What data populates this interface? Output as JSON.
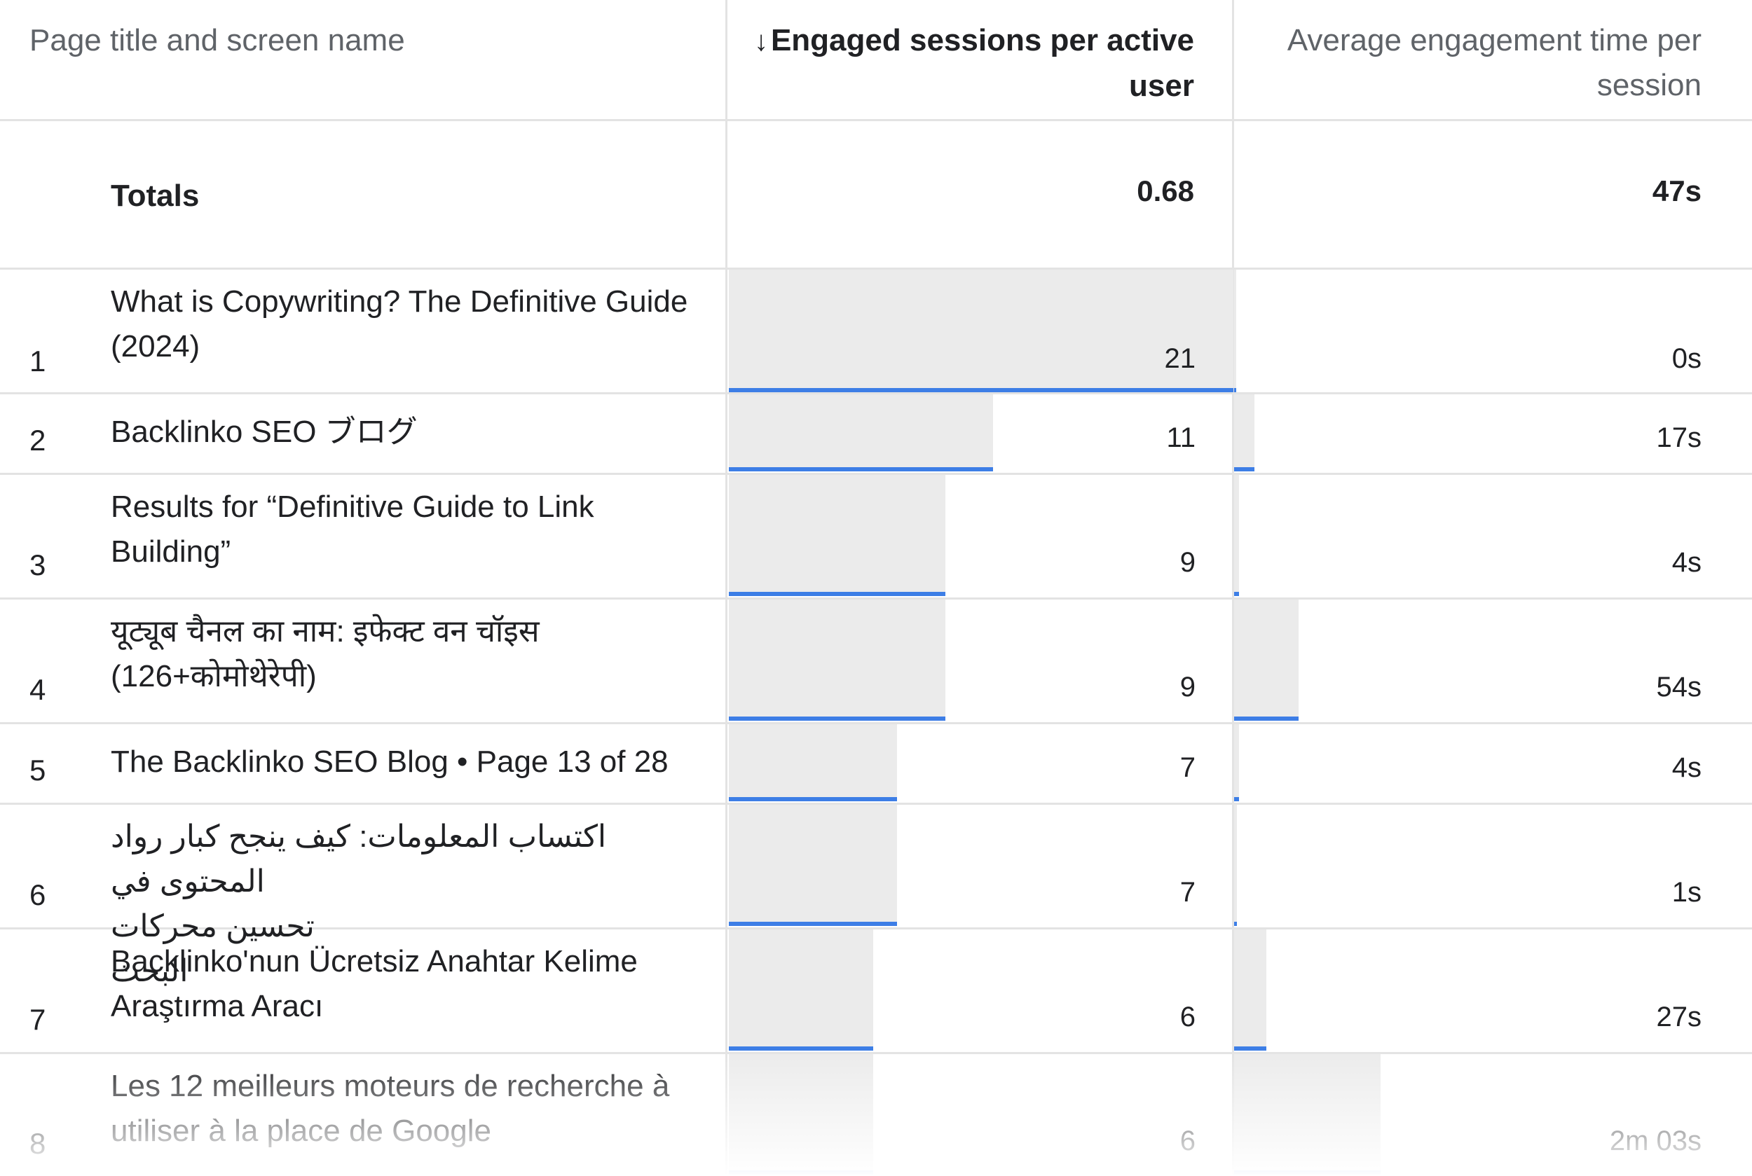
{
  "header": {
    "col1": "Page title and screen name",
    "col2_arrow": "↓",
    "col2_line1": "Engaged sessions per active",
    "col2_line2": "user",
    "col3_line1": "Average engagement time per",
    "col3_line2": "session"
  },
  "totals": {
    "label": "Totals",
    "engaged": "0.68",
    "avg_time": "47s"
  },
  "rows": [
    {
      "rank": "1",
      "title1": "What is Copywriting? The Definitive Guide",
      "title2": "(2024)",
      "engaged": "21",
      "engaged_fraction": 1.0,
      "time": "0s",
      "time_fraction": 0.0
    },
    {
      "rank": "2",
      "title1": "Backlinko SEO ブログ",
      "title2": "",
      "engaged": "11",
      "engaged_fraction": 0.524,
      "time": "17s",
      "time_fraction": 0.14
    },
    {
      "rank": "3",
      "title1": "Results for “Definitive Guide to Link",
      "title2": "Building”",
      "engaged": "9",
      "engaged_fraction": 0.429,
      "time": "4s",
      "time_fraction": 0.033
    },
    {
      "rank": "4",
      "title1": "यूट्यूब चैनल का नाम: इफेक्ट वन चॉइस",
      "title2": "(126+कोमोथेरेपी)",
      "engaged": "9",
      "engaged_fraction": 0.429,
      "time": "54s",
      "time_fraction": 0.44
    },
    {
      "rank": "5",
      "title1": "The Backlinko SEO Blog • Page 13 of 28",
      "title2": "",
      "engaged": "7",
      "engaged_fraction": 0.333,
      "time": "4s",
      "time_fraction": 0.033
    },
    {
      "rank": "6",
      "title1": "اكتساب المعلومات: كيف ينجح كبار رواد المحتوى في",
      "title2": "تحسين محركات البحث",
      "engaged": "7",
      "engaged_fraction": 0.333,
      "time": "1s",
      "time_fraction": 0.008
    },
    {
      "rank": "7",
      "title1": "Backlinko'nun Ücretsiz Anahtar Kelime",
      "title2": "Araştırma Aracı",
      "engaged": "6",
      "engaged_fraction": 0.286,
      "time": "27s",
      "time_fraction": 0.22
    },
    {
      "rank": "8",
      "title1": "Les 12 meilleurs moteurs de recherche à",
      "title2": "utiliser à la place de Google",
      "engaged": "6",
      "engaged_fraction": 0.286,
      "time": "2m 03s",
      "time_fraction": 1.0
    }
  ],
  "colors": {
    "accent": "#3d7ee6",
    "bar_fill": "#ebebeb",
    "border": "#e3e3e3",
    "muted_text": "#5f6368"
  }
}
